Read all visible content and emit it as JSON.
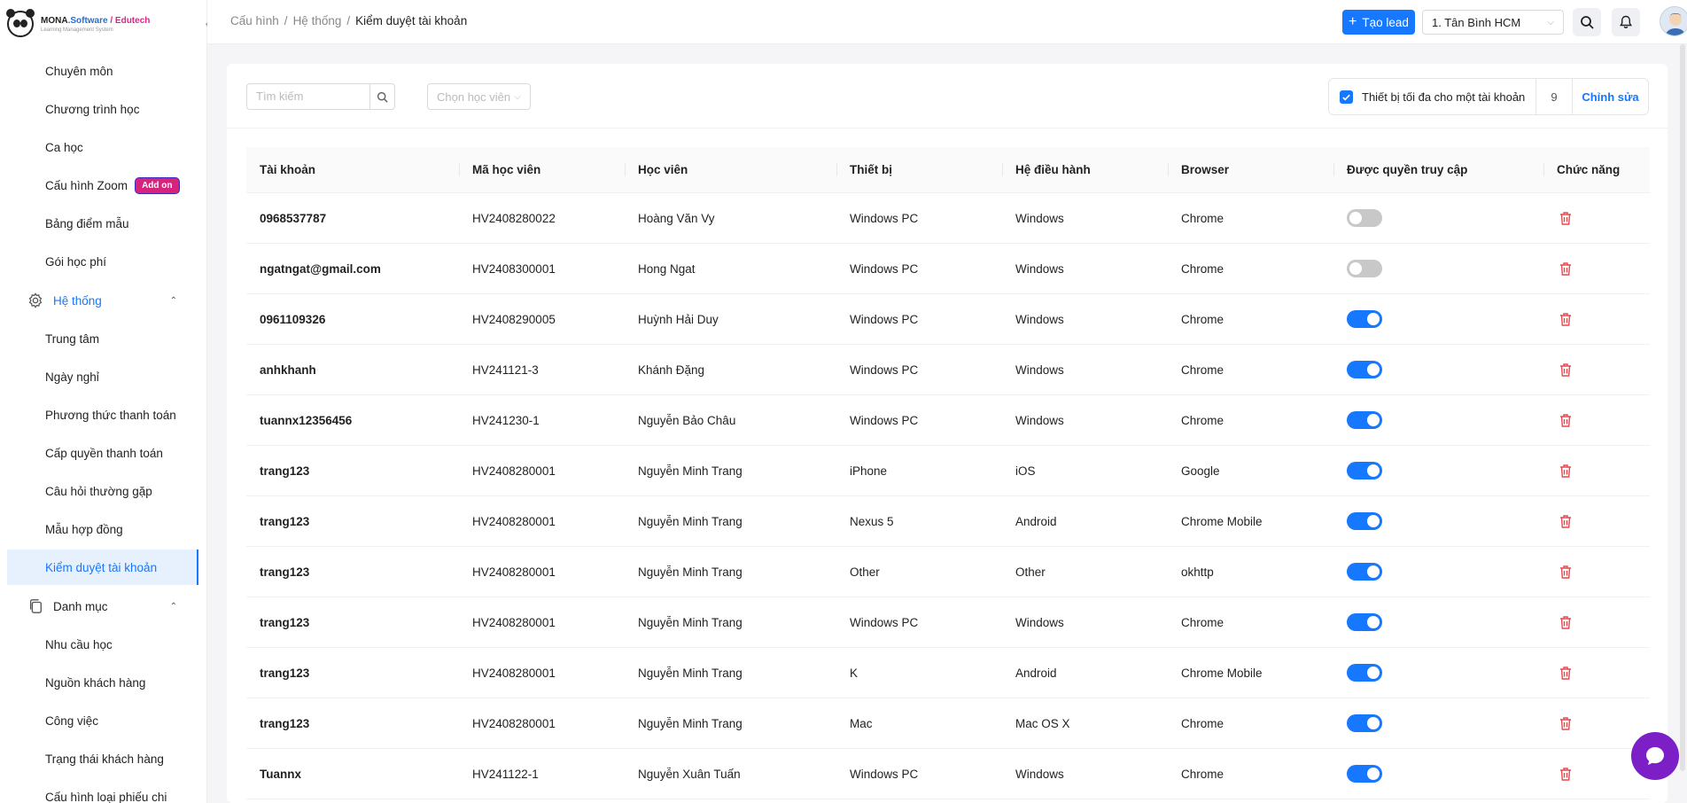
{
  "logo": {
    "brand": "MONA",
    "software": ".Software",
    "edu": " / Edutech",
    "tagline": "Learning Management System"
  },
  "sidebar": {
    "items": [
      {
        "label": "Chuyên môn"
      },
      {
        "label": "Chương trình học"
      },
      {
        "label": "Ca học"
      },
      {
        "label": "Cấu hình Zoom",
        "badge": "Add on"
      },
      {
        "label": "Bảng điểm mẫu"
      },
      {
        "label": "Gói học phí"
      }
    ],
    "group_system": "Hệ thống",
    "system_items": [
      {
        "label": "Trung tâm"
      },
      {
        "label": "Ngày nghỉ"
      },
      {
        "label": "Phương thức thanh toán"
      },
      {
        "label": "Cấp quyền thanh toán"
      },
      {
        "label": "Câu hỏi thường gặp"
      },
      {
        "label": "Mẫu hợp đồng"
      },
      {
        "label": "Kiểm duyệt tài khoản"
      }
    ],
    "group_category": "Danh mục",
    "category_items": [
      {
        "label": "Nhu cầu học"
      },
      {
        "label": "Nguồn khách hàng"
      },
      {
        "label": "Công việc"
      },
      {
        "label": "Trạng thái khách hàng"
      },
      {
        "label": "Cấu hình loại phiếu chi"
      }
    ]
  },
  "header": {
    "breadcrumb": [
      "Cấu hình",
      "Hệ thống",
      "Kiểm duyệt tài khoản"
    ],
    "create_lead": "Tạo lead",
    "branch": "1. Tân Bình HCM"
  },
  "toolbar": {
    "search_placeholder": "Tìm kiếm",
    "student_select": "Chọn học viên",
    "max_device_label": "Thiết bị tối đa cho một tài khoản",
    "max_device_value": "9",
    "edit_label": "Chỉnh sửa"
  },
  "table": {
    "headers": [
      "Tài khoản",
      "Mã học viên",
      "Học viên",
      "Thiết bị",
      "Hệ điều hành",
      "Browser",
      "Được quyền truy cập",
      "Chức năng"
    ],
    "rows": [
      {
        "account": "0968537787",
        "code": "HV2408280022",
        "student": "Hoàng Văn Vy",
        "device": "Windows PC",
        "os": "Windows",
        "browser": "Chrome",
        "access": false
      },
      {
        "account": "ngatngat@gmail.com",
        "code": "HV2408300001",
        "student": "Hong Ngat",
        "device": "Windows PC",
        "os": "Windows",
        "browser": "Chrome",
        "access": false
      },
      {
        "account": "0961109326",
        "code": "HV2408290005",
        "student": "Huỳnh Hải Duy",
        "device": "Windows PC",
        "os": "Windows",
        "browser": "Chrome",
        "access": true
      },
      {
        "account": "anhkhanh",
        "code": "HV241121-3",
        "student": "Khánh Đặng",
        "device": "Windows PC",
        "os": "Windows",
        "browser": "Chrome",
        "access": true
      },
      {
        "account": "tuannx12356456",
        "code": "HV241230-1",
        "student": "Nguyễn Bảo Châu",
        "device": "Windows PC",
        "os": "Windows",
        "browser": "Chrome",
        "access": true
      },
      {
        "account": "trang123",
        "code": "HV2408280001",
        "student": "Nguyễn Minh Trang",
        "device": "iPhone",
        "os": "iOS",
        "browser": "Google",
        "access": true
      },
      {
        "account": "trang123",
        "code": "HV2408280001",
        "student": "Nguyễn Minh Trang",
        "device": "Nexus 5",
        "os": "Android",
        "browser": "Chrome Mobile",
        "access": true
      },
      {
        "account": "trang123",
        "code": "HV2408280001",
        "student": "Nguyễn Minh Trang",
        "device": "Other",
        "os": "Other",
        "browser": "okhttp",
        "access": true
      },
      {
        "account": "trang123",
        "code": "HV2408280001",
        "student": "Nguyễn Minh Trang",
        "device": "Windows PC",
        "os": "Windows",
        "browser": "Chrome",
        "access": true
      },
      {
        "account": "trang123",
        "code": "HV2408280001",
        "student": "Nguyễn Minh Trang",
        "device": "K",
        "os": "Android",
        "browser": "Chrome Mobile",
        "access": true
      },
      {
        "account": "trang123",
        "code": "HV2408280001",
        "student": "Nguyễn Minh Trang",
        "device": "Mac",
        "os": "Mac OS X",
        "browser": "Chrome",
        "access": true
      },
      {
        "account": "Tuannx",
        "code": "HV241122-1",
        "student": "Nguyễn Xuân Tuấn",
        "device": "Windows PC",
        "os": "Windows",
        "browser": "Chrome",
        "access": true
      }
    ]
  },
  "colors": {
    "primary": "#1677ff",
    "danger": "#e5484d",
    "addon": "#d6247d",
    "chat": "#7c1fc6"
  }
}
